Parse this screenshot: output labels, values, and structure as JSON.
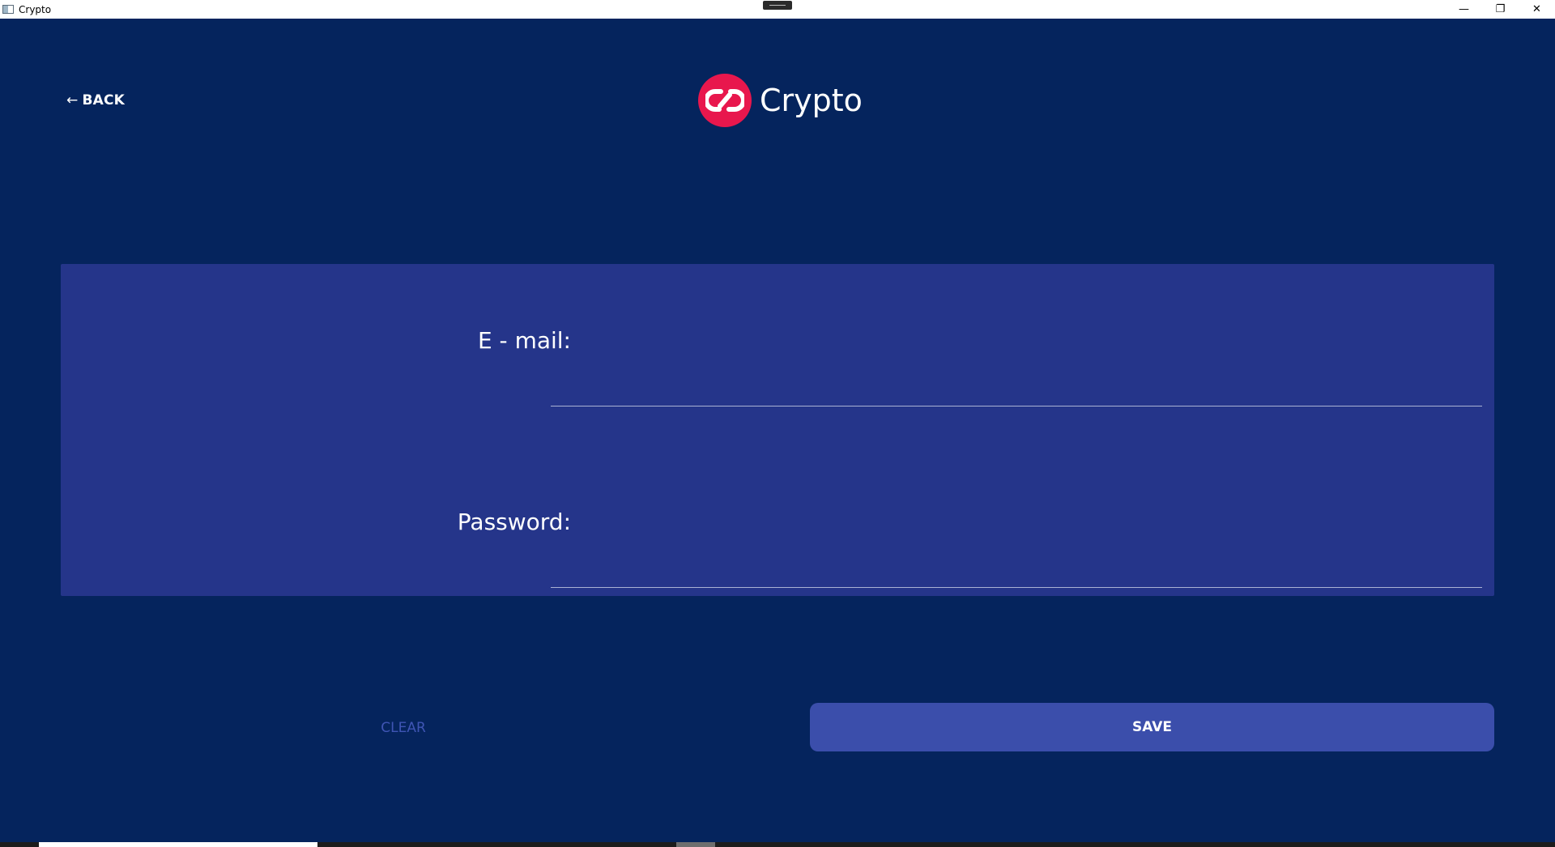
{
  "window": {
    "title": "Crypto",
    "controls": {
      "minimize_glyph": "—",
      "restore_glyph": "❐",
      "close_glyph": "✕"
    }
  },
  "header": {
    "back_label": "BACK",
    "back_arrow": "←",
    "brand_name": "Crypto",
    "logo_icon": "crypto-link-logo",
    "logo_color": "#e8174d"
  },
  "form": {
    "email_label": "E - mail:",
    "email_value": "",
    "password_label": "Password:",
    "password_value": ""
  },
  "actions": {
    "clear_label": "CLEAR",
    "save_label": "SAVE"
  },
  "colors": {
    "background": "#05245d",
    "card": "#25358a",
    "save_button": "#3b4eab",
    "clear_text": "#3f55b4"
  }
}
